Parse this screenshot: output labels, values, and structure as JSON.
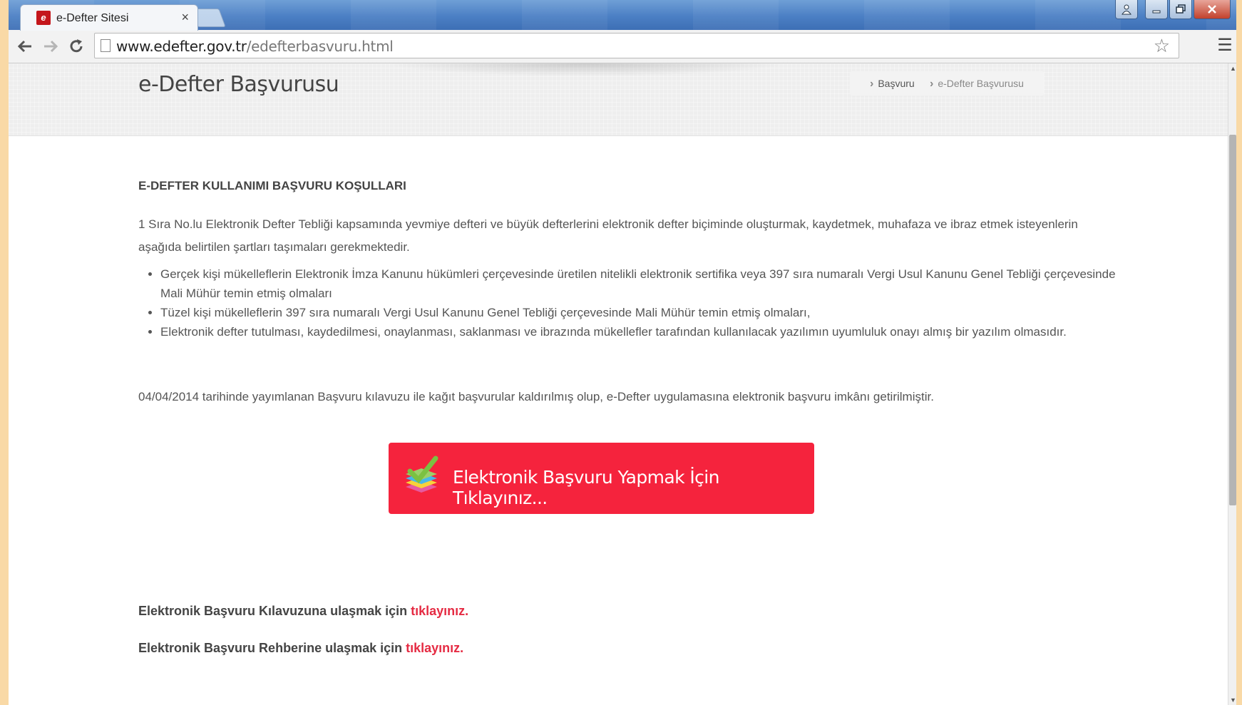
{
  "browser": {
    "tab_title": "e-Defter Sitesi",
    "tab_close": "×",
    "favicon_letter": "e",
    "url_host": "www.edefter.gov.tr",
    "url_path": "/edefterbasvuru.html",
    "icons": {
      "back": "arrow-left-icon",
      "forward": "arrow-right-icon",
      "reload": "reload-icon",
      "page": "page-icon",
      "star": "star-icon",
      "menu": "hamburger-menu-icon"
    }
  },
  "window_controls": {
    "user": "user-icon",
    "minimize": "minimize-icon",
    "maximize": "maximize-icon",
    "close": "close-icon"
  },
  "header": {
    "title": "e-Defter Başvurusu",
    "breadcrumb": [
      "Başvuru",
      "e-Defter Başvurusu"
    ]
  },
  "content": {
    "section_title": "E-DEFTER KULLANIMI BAŞVURU KOŞULLARI",
    "intro": "1 Sıra No.lu Elektronik Defter Tebliği kapsamında yevmiye defteri ve büyük defterlerini elektronik defter biçiminde oluşturmak, kaydetmek, muhafaza ve ibraz etmek isteyenlerin aşağıda belirtilen şartları taşımaları gerekmektedir.",
    "conditions": [
      "Gerçek kişi mükelleflerin Elektronik İmza Kanunu hükümleri çerçevesinde üretilen nitelikli elektronik sertifika veya 397 sıra numaralı Vergi Usul Kanunu Genel Tebliği çerçevesinde Mali Mühür temin etmiş olmaları",
      "Tüzel kişi mükelleflerin 397 sıra numaralı Vergi Usul Kanunu Genel Tebliği çerçevesinde Mali Mühür temin etmiş olmaları,",
      "Elektronik defter tutulması, kaydedilmesi, onaylanması, saklanması ve ibrazında mükellefler tarafından kullanılacak yazılımın uyumluluk onayı almış bir yazılım olmasıdır."
    ],
    "note": "04/04/2014 tarihinde yayımlanan Başvuru kılavuzu ile kağıt başvurular kaldırılmış olup, e-Defter uygulamasına elektronik başvuru imkânı getirilmiştir.",
    "apply_button": "Elektronik Başvuru Yapmak İçin Tıklayınız...",
    "apply_icon": "checklist-books-icon",
    "guide_text": "Elektronik Başvuru Kılavuzuna ulaşmak için",
    "guide_link": "tıklayınız.",
    "manual_text": "Elektronik Başvuru Rehberine ulaşmak için",
    "manual_link": "tıklayınız."
  },
  "colors": {
    "accent": "#f5233d",
    "link": "#e52b43"
  }
}
